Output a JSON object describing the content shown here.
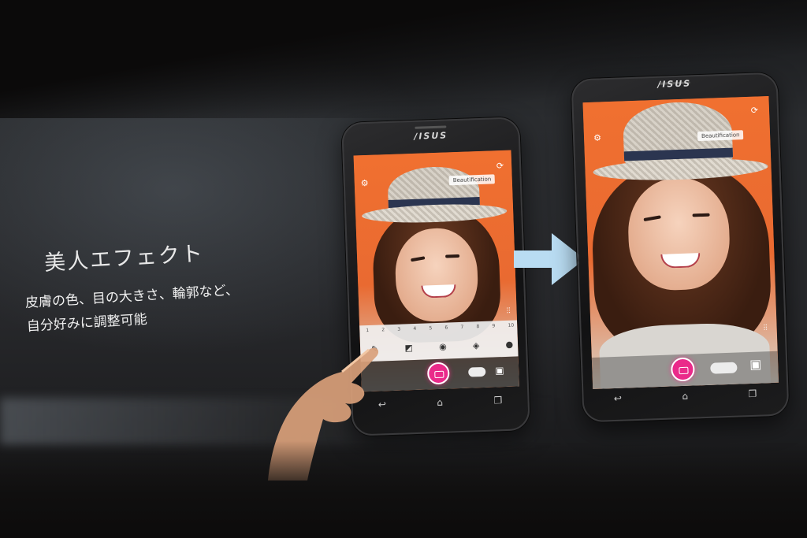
{
  "slide": {
    "title": "美人エフェクト",
    "description_lines": [
      "皮膚の色、目の大きさ、輪郭など、",
      "自分好みに調整可能"
    ]
  },
  "phones": [
    {
      "brand": "/ISUS",
      "label": "Beautification",
      "slider_numbers": [
        "1",
        "2",
        "3",
        "4",
        "5",
        "6",
        "7",
        "8",
        "9",
        "10"
      ]
    },
    {
      "brand": "/ISUS",
      "label": "Beautification"
    }
  ],
  "icons": {
    "settings": "gear-icon",
    "switch_camera": "camera-switch-icon",
    "adjust": "sliders-icon",
    "arrow": "arrow-right-icon",
    "nav_back": "back-icon",
    "nav_home": "home-icon",
    "nav_recent": "recent-apps-icon"
  },
  "colors": {
    "accent": "#ea2a8a",
    "arrow": "#b9dcf2",
    "photo_background": "#f26a2f"
  }
}
